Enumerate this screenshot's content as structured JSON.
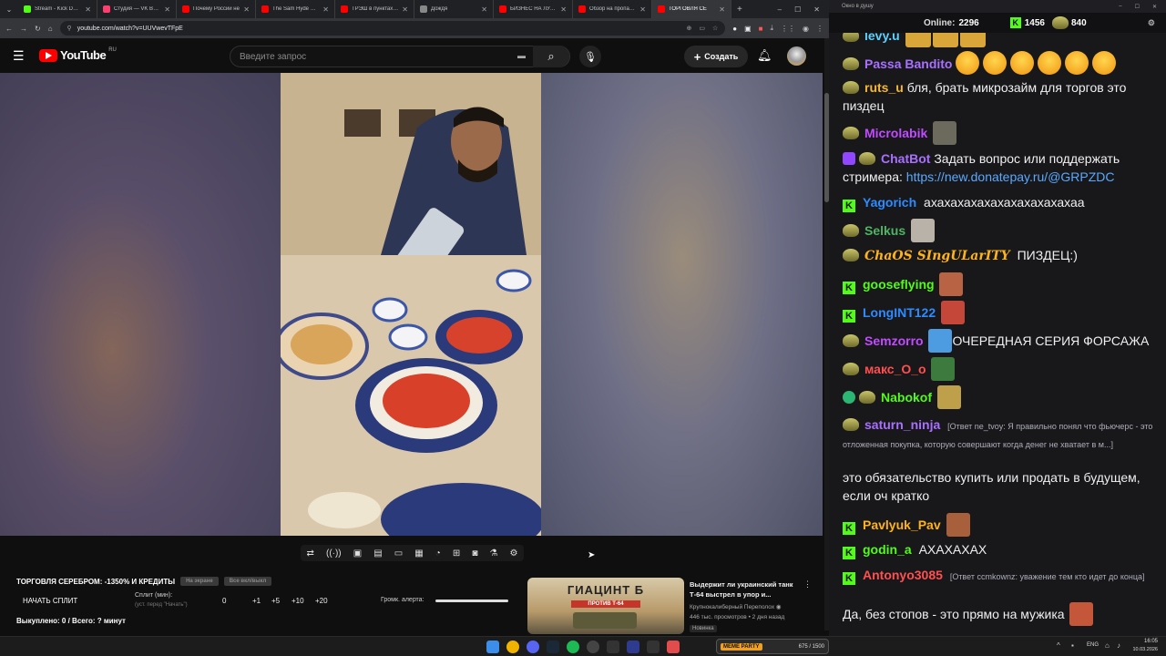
{
  "browser": {
    "tabs": [
      {
        "label": "Stream - Kick Dashb",
        "color": "#53fc18"
      },
      {
        "label": "Студия — VK Видео",
        "color": "#ff3d6e"
      },
      {
        "label": "Почему России не",
        "color": "#ff0000"
      },
      {
        "label": "The Sam Hyde Show",
        "color": "#ff0000"
      },
      {
        "label": "ТРЭШ в пунктах выд",
        "color": "#ff0000"
      },
      {
        "label": "Дождя",
        "color": "#888888"
      },
      {
        "label": "БИЗНЕС НА ЛУДОМ",
        "color": "#ff0000"
      },
      {
        "label": "Обзор на пропаган",
        "color": "#ff0000"
      },
      {
        "label": "ТОРГОВЛЯ СЕ",
        "color": "#ff0000"
      }
    ],
    "url": "youtube.com/watch?v=UUVwevTFpE"
  },
  "youtube": {
    "logo_text": "YouTube",
    "logo_region": "RU",
    "search_placeholder": "Введите запрос",
    "create_label": "Создать"
  },
  "overlay": {
    "title": "ТОРГОВЛЯ СЕРЕБРОМ: -1350% И КРЕДИТЫ",
    "pill1": "На экране",
    "pill2": "Все вкл/выкл",
    "start_split": "НАЧАТЬ СПЛИТ",
    "split_label": "Сплит (мин):",
    "split_hint": "(уст. перед \"Начать\")",
    "split_value": "0",
    "buttons": [
      "+1",
      "+5",
      "+10",
      "+20"
    ],
    "alert_volume": "Громк. алерта:",
    "bought": "Выкуплено: 0 / Всего: ? минут"
  },
  "recommendation": {
    "thumb_title": "ГИАЦИНТ Б",
    "thumb_sub": "ПРОТИВ Т-64",
    "title": "Выдержит ли украинский танк Т-64 выстрел в упор и...",
    "channel": "Крупнокалиберный Переполох",
    "meta": "446 тыс. просмотров • 2 дня назад",
    "badge": "Новинка"
  },
  "chat": {
    "window_title": "Окно в душу",
    "online_label": "Online:",
    "online_count": "2296",
    "kick_count": "1456",
    "other_count": "840",
    "messages": [
      {
        "user": "levy.u",
        "color": "#5ad1ff",
        "text": ""
      },
      {
        "user": "Passa Bandito",
        "color": "#a970ff",
        "text": ""
      },
      {
        "user": "ruts_u",
        "color": "#f7b733",
        "text": "бля, брать микрозайм для торгов это пиздец"
      },
      {
        "user": "Microlabik",
        "color": "#c14bff",
        "text": ""
      },
      {
        "user": "ChatBot",
        "color": "#a970ff",
        "text": "Задать вопрос или поддержать стримера:",
        "link": "https://new.donatepay.ru/@GRPZDC"
      },
      {
        "user": "Yagorich",
        "color": "#2e8bff",
        "text": "ахахахахахахахахахахахаа"
      },
      {
        "user": "Selkus",
        "color": "#4fb562",
        "text": ""
      },
      {
        "user": "ChaOS SIngULarITY",
        "color": "#ffb31a",
        "text": "ПИЗДЕЦ:)"
      },
      {
        "user": "gooseflying",
        "color": "#53fc18",
        "text": ""
      },
      {
        "user": "LongINT122",
        "color": "#2e8bff",
        "text": ""
      },
      {
        "user": "Semzorro",
        "color": "#c14bff",
        "text": "ОЧЕРЕДНАЯ СЕРИЯ ФОРСАЖА"
      },
      {
        "user": "макс_О_о",
        "color": "#ff4f4f",
        "text": ""
      },
      {
        "user": "Nabokof",
        "color": "#53fc18",
        "text": ""
      },
      {
        "user": "saturn_ninja",
        "color": "#a970ff",
        "reply": "[Ответ ne_tvoy: Я правильно понял что фьючерс - это отложенная покупка, которую совершают когда денег не хватает в м...]",
        "text": "это обязательство купить или продать в будущем, если оч кратко"
      },
      {
        "user": "Pavlyuk_Pav",
        "color": "#ffb31a",
        "text": ""
      },
      {
        "user": "godin_a",
        "color": "#53fc18",
        "text": "АХАХАХАХ"
      },
      {
        "user": "Antonyo3085",
        "color": "#ff4f4f",
        "reply": "[Ответ ccmkownz: уважение тем кто идет до конца]",
        "text": "Да, без стопов - это прямо на мужика"
      }
    ]
  },
  "taskbar": {
    "lang": "ENG",
    "time": "16:05",
    "date": "10.03.2026",
    "widget": "MEME PARTY",
    "widget_count": "675 / 1500"
  },
  "colors": {
    "kick_green": "#53fc18",
    "youtube_red": "#ff0000",
    "chat_bg": "#18181b"
  }
}
